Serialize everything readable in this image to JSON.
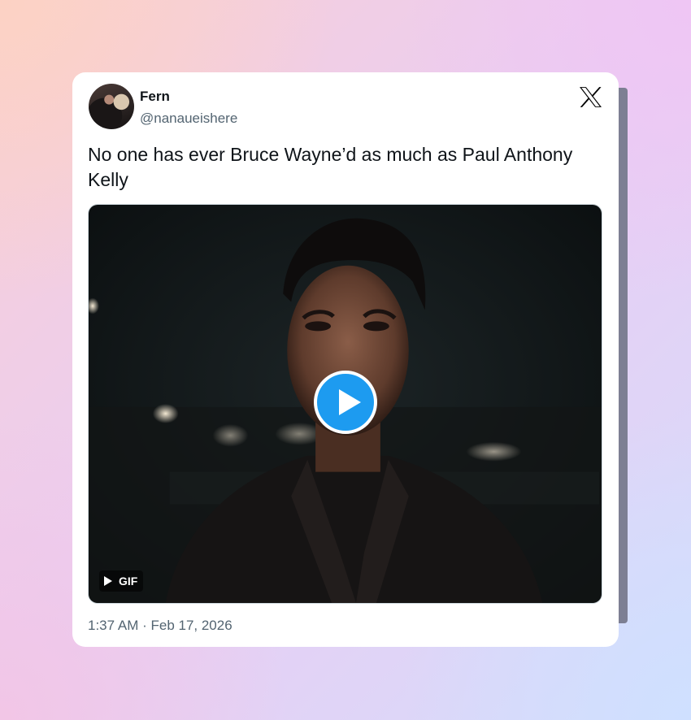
{
  "tweet": {
    "author_name": "Fern",
    "author_handle": "@nanaueishere",
    "text": "No one has ever Bruce Wayne’d as much as Paul Anthony Kelly",
    "timestamp": "1:37 AM · Feb 17, 2026",
    "media": {
      "type": "gif",
      "badge_label": "GIF",
      "play_icon": "play-icon"
    }
  },
  "icons": {
    "platform": "x-logo-icon",
    "avatar": "avatar"
  },
  "colors": {
    "accent": "#1d9bf0",
    "text_primary": "#0f1419",
    "text_secondary": "#536471"
  }
}
